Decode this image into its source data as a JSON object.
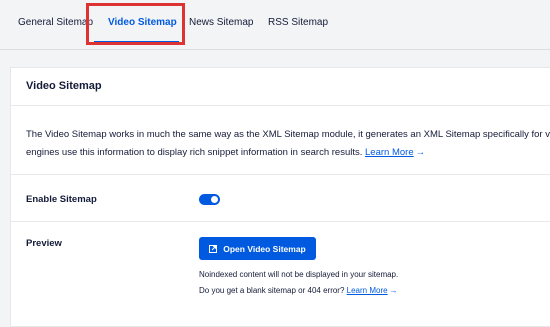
{
  "tabs": [
    {
      "label": "General Sitemap"
    },
    {
      "label": "Video Sitemap"
    },
    {
      "label": "News Sitemap"
    },
    {
      "label": "RSS Sitemap"
    }
  ],
  "active_tab": "Video Sitemap",
  "card": {
    "title": "Video Sitemap",
    "description_line1": "The Video Sitemap works in much the same way as the XML Sitemap module, it generates an XML Sitemap specifically for v",
    "description_line2": "engines use this information to display rich snippet information in search results.",
    "learn_more_label": "Learn More"
  },
  "enable_sitemap": {
    "label": "Enable Sitemap",
    "enabled": true
  },
  "preview": {
    "label": "Preview",
    "button_label": "Open Video Sitemap",
    "note1": "Noindexed content will not be displayed in your sitemap.",
    "note2": "Do you get a blank sitemap or 404 error?",
    "learn_more_label": "Learn More"
  },
  "icons": {
    "external": "external-link-icon",
    "arrow": "arrow-right-icon"
  },
  "colors": {
    "accent": "#005ae0",
    "highlight": "#dd3333",
    "text": "#141b38",
    "background": "#f3f4f6"
  }
}
